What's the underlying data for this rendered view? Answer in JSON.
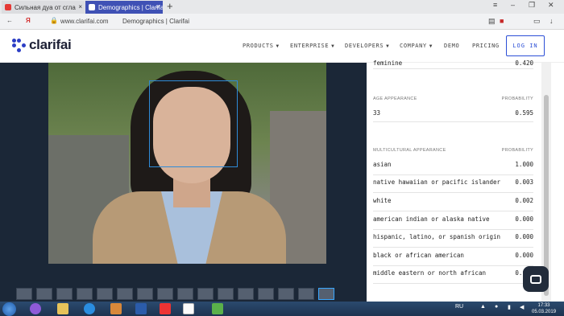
{
  "browser": {
    "tabs": [
      {
        "label": "Сильная дуа от сгла",
        "close": "×"
      },
      {
        "label": "Demographics | Clarifai",
        "close": "×"
      }
    ],
    "new_tab": "+",
    "nav": {
      "back": "←",
      "brand": "Я"
    },
    "url": "www.clarifai.com",
    "page_title": "Demographics | Clarifai",
    "window": {
      "menu": "≡",
      "minimize": "–",
      "maximize": "❐",
      "close": "✕"
    }
  },
  "site": {
    "logo": "clarifai",
    "menu": [
      "PRODUCTS",
      "ENTERPRISE",
      "DEVELOPERS",
      "COMPANY",
      "DEMO",
      "PRICING"
    ],
    "login": "LOG IN"
  },
  "results": {
    "top_row": {
      "label": "feminine",
      "value": "0.420"
    },
    "age": {
      "header": "AGE APPEARANCE",
      "prob_header": "PROBABILITY",
      "rows": [
        {
          "label": "33",
          "value": "0.595"
        }
      ]
    },
    "multicultural": {
      "header": "MULTICULTURAL APPEARANCE",
      "prob_header": "PROBABILITY",
      "rows": [
        {
          "label": "asian",
          "value": "1.000"
        },
        {
          "label": "native hawaiian or pacific islander",
          "value": "0.003"
        },
        {
          "label": "white",
          "value": "0.002"
        },
        {
          "label": "american indian or alaska native",
          "value": "0.000"
        },
        {
          "label": "hispanic, latino, or spanish origin",
          "value": "0.000"
        },
        {
          "label": "black or african american",
          "value": "0.000"
        },
        {
          "label": "middle eastern or north african",
          "value": "0.000"
        }
      ]
    }
  },
  "taskbar": {
    "lang": "RU",
    "time": "17:33",
    "date": "05.03.2019"
  }
}
